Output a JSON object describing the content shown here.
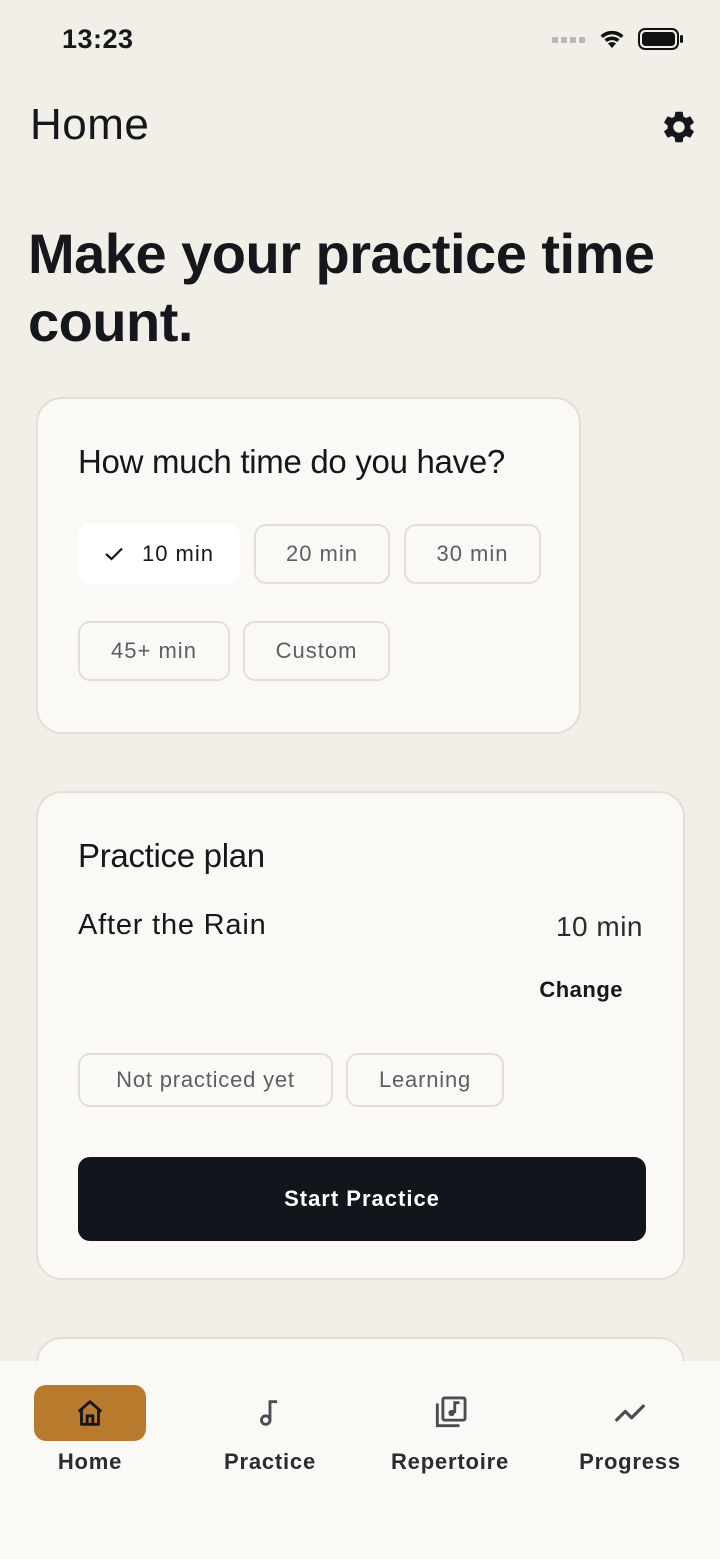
{
  "status_bar": {
    "time": "13:23"
  },
  "header": {
    "title": "Home"
  },
  "hero": {
    "headline": "Make your practice time count."
  },
  "time_card": {
    "title": "How much time do you have?",
    "options": [
      "10 min",
      "20 min",
      "30 min",
      "45+ min",
      "Custom"
    ],
    "selected": "10 min"
  },
  "plan_card": {
    "title": "Practice plan",
    "piece": "After the Rain",
    "duration": "10 min",
    "change_label": "Change",
    "tags": [
      "Not practiced yet",
      "Learning"
    ],
    "start_label": "Start Practice"
  },
  "tabs": [
    {
      "label": "Home",
      "icon": "home-icon",
      "active": true
    },
    {
      "label": "Practice",
      "icon": "music-note-icon",
      "active": false
    },
    {
      "label": "Repertoire",
      "icon": "library-music-icon",
      "active": false
    },
    {
      "label": "Progress",
      "icon": "trending-icon",
      "active": false
    }
  ],
  "colors": {
    "accent": "#b87a2c",
    "primary_button": "#12151b",
    "background": "#f2efe8"
  }
}
